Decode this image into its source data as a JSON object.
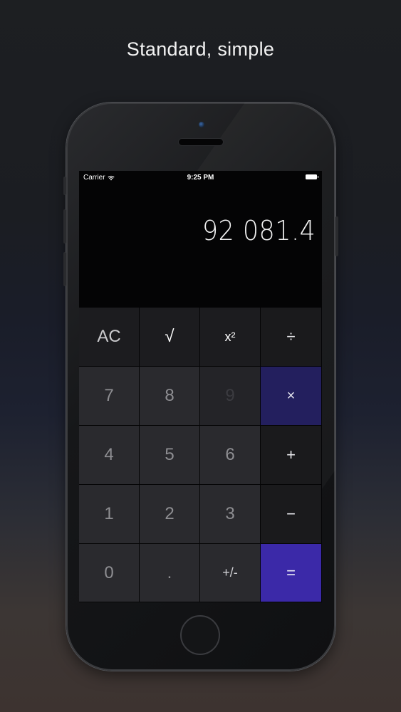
{
  "headline": "Standard, simple",
  "status_bar": {
    "carrier": "Carrier",
    "time": "9:25 PM"
  },
  "display": {
    "value": "92 081.4"
  },
  "keys": {
    "clear": "AC",
    "sqrt": "√",
    "square": "x²",
    "divide": "÷",
    "seven": "7",
    "eight": "8",
    "nine": "9",
    "multiply": "×",
    "four": "4",
    "five": "5",
    "six": "6",
    "plus": "+",
    "one": "1",
    "two": "2",
    "three": "3",
    "minus": "−",
    "zero": "0",
    "decimal": ".",
    "sign": "+/-",
    "equals": "="
  },
  "colors": {
    "multiply_key": "#231f5e",
    "equals_key": "#3b29a8"
  }
}
